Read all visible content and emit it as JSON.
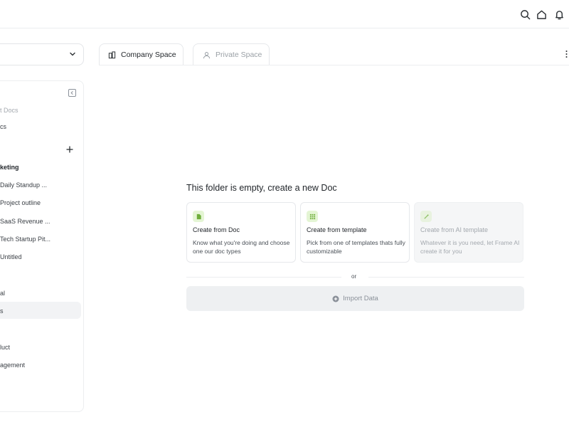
{
  "sidebar": {
    "items": [
      {
        "label": "t Docs"
      },
      {
        "label": "cs"
      },
      {
        "label": "keting"
      },
      {
        "label": "Daily Standup ..."
      },
      {
        "label": "Project outline"
      },
      {
        "label": "SaaS Revenue ..."
      },
      {
        "label": "Tech Startup Pit..."
      },
      {
        "label": "Untitled"
      },
      {
        "label": "al"
      },
      {
        "label": "s"
      },
      {
        "label": "luct"
      },
      {
        "label": "agement"
      }
    ]
  },
  "tabs": [
    {
      "label": "Company Space"
    },
    {
      "label": "Private Space"
    }
  ],
  "empty_state": {
    "title": "This folder is empty, create a new Doc",
    "cards": [
      {
        "title": "Create from Doc",
        "desc": "Know what you're doing and choose one our doc types",
        "icon": "doc-icon"
      },
      {
        "title": "Create from template",
        "desc": "Pick from one of templates thats fully customizable",
        "icon": "grid-icon"
      },
      {
        "title": "Create from AI template",
        "desc": "Whatever it is you need, let Frame AI create it for you",
        "icon": "magic-wand-icon"
      }
    ],
    "or_label": "or",
    "import_label": "Import Data"
  },
  "colors": {
    "accent_green": "#e4f5d4",
    "border": "#e6e8eb"
  }
}
